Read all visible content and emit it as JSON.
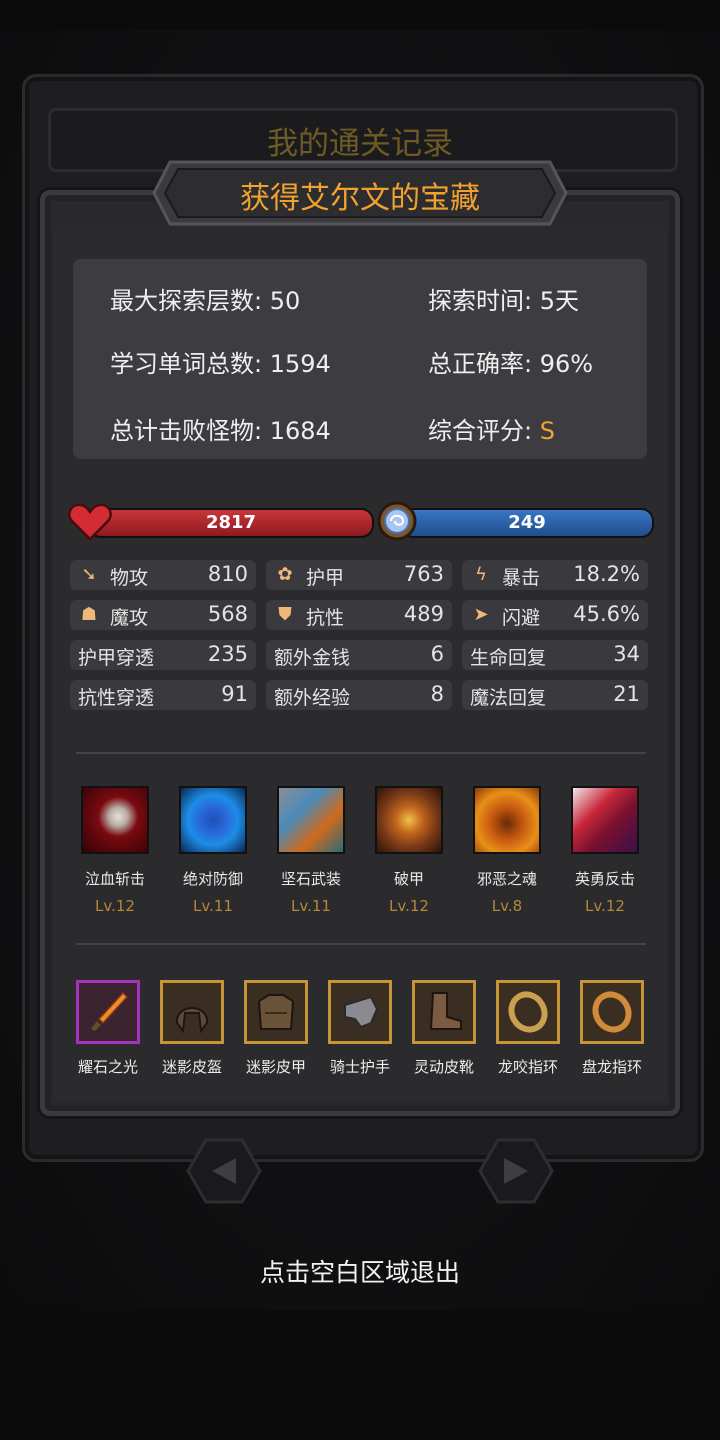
{
  "back_title": "我的通关记录",
  "title": "获得艾尔文的宝藏",
  "summary": {
    "max_floor": "最大探索层数: 50",
    "time": "探索时间: 5天",
    "words": "学习单词总数: 1594",
    "accuracy": "总正确率: 96%",
    "monsters": "总计击败怪物: 1684",
    "rating_label": "综合评分: ",
    "rating_value": "S"
  },
  "hp": "2817",
  "mp": "249",
  "stats": [
    {
      "label": "物攻",
      "value": "810",
      "icon": "sword-icon"
    },
    {
      "label": "护甲",
      "value": "763",
      "icon": "paw-icon"
    },
    {
      "label": "暴击",
      "value": "18.2%",
      "icon": "lightning-icon"
    },
    {
      "label": "魔攻",
      "value": "568",
      "icon": "magic-boot-icon"
    },
    {
      "label": "抗性",
      "value": "489",
      "icon": "shield-icon"
    },
    {
      "label": "闪避",
      "value": "45.6%",
      "icon": "running-icon"
    },
    {
      "label": "护甲穿透",
      "value": "235"
    },
    {
      "label": "额外金钱",
      "value": "6"
    },
    {
      "label": "生命回复",
      "value": "34"
    },
    {
      "label": "抗性穿透",
      "value": "91"
    },
    {
      "label": "额外经验",
      "value": "8"
    },
    {
      "label": "魔法回复",
      "value": "21"
    }
  ],
  "skills": [
    {
      "name": "泣血斩击",
      "level": "Lv.12",
      "icon": "bloody-axe-icon"
    },
    {
      "name": "绝对防御",
      "level": "Lv.11",
      "icon": "blue-shield-icon"
    },
    {
      "name": "坚石武装",
      "level": "Lv.11",
      "icon": "stone-claw-icon"
    },
    {
      "name": "破甲",
      "level": "Lv.12",
      "icon": "broken-shield-icon"
    },
    {
      "name": "邪恶之魂",
      "level": "Lv.8",
      "icon": "demon-soul-icon"
    },
    {
      "name": "英勇反击",
      "level": "Lv.12",
      "icon": "red-blade-icon"
    }
  ],
  "equipment": [
    {
      "name": "耀石之光",
      "icon": "dagger-icon"
    },
    {
      "name": "迷影皮盔",
      "icon": "helmet-icon"
    },
    {
      "name": "迷影皮甲",
      "icon": "leather-armor-icon"
    },
    {
      "name": "骑士护手",
      "icon": "gauntlet-icon"
    },
    {
      "name": "灵动皮靴",
      "icon": "boot-icon"
    },
    {
      "name": "龙咬指环",
      "icon": "ring-icon"
    },
    {
      "name": "盘龙指环",
      "icon": "ring-icon"
    }
  ],
  "exit_hint": "点击空白区域退出",
  "colors": {
    "accent": "#f0a22e",
    "hp": "#b32a2e",
    "mp": "#2b62a8",
    "gold_frame": "#c69536",
    "purple_frame": "#a234b9"
  }
}
